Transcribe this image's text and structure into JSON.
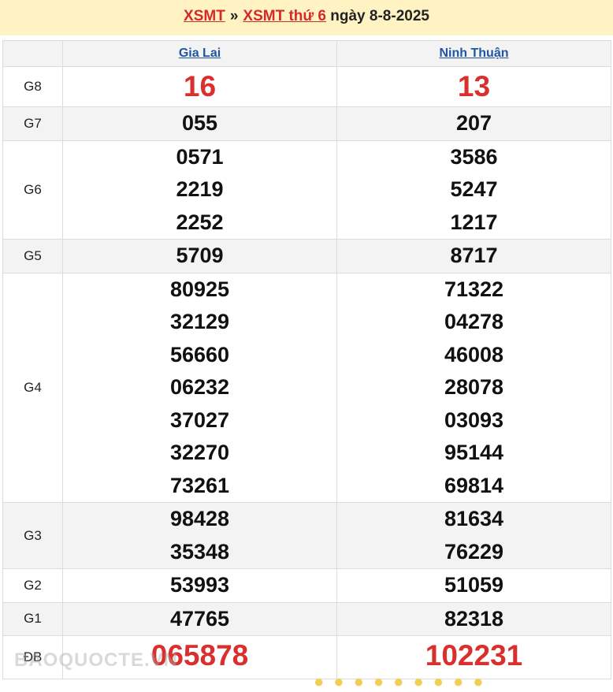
{
  "header": {
    "crumb1": "XSMT",
    "separator": "»",
    "crumb2": "XSMT thứ 6",
    "date_text": "ngày 8-8-2025"
  },
  "table": {
    "provinces": [
      "Gia Lai",
      "Ninh Thuận"
    ],
    "rows": [
      {
        "prize": "G8",
        "gia_lai": [
          "16"
        ],
        "ninh_thuan": [
          "13"
        ]
      },
      {
        "prize": "G7",
        "gia_lai": [
          "055"
        ],
        "ninh_thuan": [
          "207"
        ]
      },
      {
        "prize": "G6",
        "gia_lai": [
          "0571",
          "2219",
          "2252"
        ],
        "ninh_thuan": [
          "3586",
          "5247",
          "1217"
        ]
      },
      {
        "prize": "G5",
        "gia_lai": [
          "5709"
        ],
        "ninh_thuan": [
          "8717"
        ]
      },
      {
        "prize": "G4",
        "gia_lai": [
          "80925",
          "32129",
          "56660",
          "06232",
          "37027",
          "32270",
          "73261"
        ],
        "ninh_thuan": [
          "71322",
          "04278",
          "46008",
          "28078",
          "03093",
          "95144",
          "69814"
        ]
      },
      {
        "prize": "G3",
        "gia_lai": [
          "98428",
          "35348"
        ],
        "ninh_thuan": [
          "81634",
          "76229"
        ]
      },
      {
        "prize": "G2",
        "gia_lai": [
          "53993"
        ],
        "ninh_thuan": [
          "51059"
        ]
      },
      {
        "prize": "G1",
        "gia_lai": [
          "47765"
        ],
        "ninh_thuan": [
          "82318"
        ]
      },
      {
        "prize": "ĐB",
        "gia_lai": [
          "065878"
        ],
        "ninh_thuan": [
          "102231"
        ]
      }
    ]
  },
  "watermark": "BAOQUOCTE.VN",
  "colors": {
    "header_bg": "#fff3c4",
    "accent_red": "#d42a2a",
    "link_blue": "#2255a0",
    "row_alt": "#f3f3f3"
  }
}
